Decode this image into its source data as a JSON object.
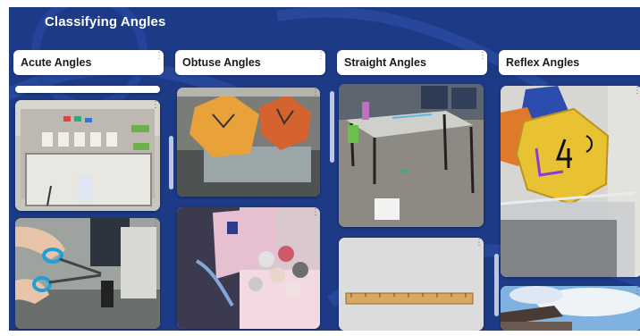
{
  "board": {
    "title": "Classifying Angles"
  },
  "columns": [
    {
      "label": "Acute Angles"
    },
    {
      "label": "Obtuse Angles"
    },
    {
      "label": "Straight Angles"
    },
    {
      "label": "Reflex Angles"
    }
  ],
  "colors": {
    "background": "#1d3a86",
    "card": "#ffffff",
    "header_text": "#1c1c1c"
  },
  "icons": {
    "menu": "kebab-menu-icon"
  }
}
